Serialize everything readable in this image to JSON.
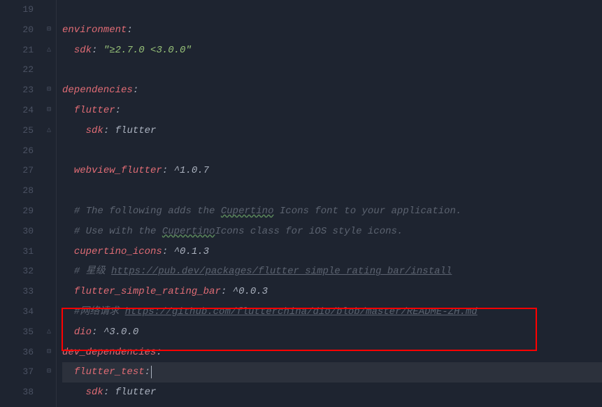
{
  "lines": [
    {
      "num": "19",
      "fold": "",
      "segments": []
    },
    {
      "num": "20",
      "fold": "⊟",
      "segments": [
        {
          "cls": "key",
          "t": "environment"
        },
        {
          "cls": "colon",
          "t": ":"
        }
      ]
    },
    {
      "num": "21",
      "fold": "△",
      "indent": 1,
      "segments": [
        {
          "cls": "key",
          "t": "sdk"
        },
        {
          "cls": "colon",
          "t": ": "
        },
        {
          "cls": "string",
          "t": "\"≥2.7.0 <3.0.0\""
        }
      ]
    },
    {
      "num": "22",
      "fold": "",
      "segments": []
    },
    {
      "num": "23",
      "fold": "⊟",
      "segments": [
        {
          "cls": "key",
          "t": "dependencies"
        },
        {
          "cls": "colon",
          "t": ":"
        }
      ]
    },
    {
      "num": "24",
      "fold": "⊟",
      "indent": 1,
      "segments": [
        {
          "cls": "key",
          "t": "flutter"
        },
        {
          "cls": "colon",
          "t": ":"
        }
      ]
    },
    {
      "num": "25",
      "fold": "△",
      "indent": 2,
      "segments": [
        {
          "cls": "key",
          "t": "sdk"
        },
        {
          "cls": "colon",
          "t": ": "
        },
        {
          "cls": "plain",
          "t": "flutter"
        }
      ]
    },
    {
      "num": "26",
      "fold": "",
      "segments": []
    },
    {
      "num": "27",
      "fold": "",
      "indent": 1,
      "segments": [
        {
          "cls": "key",
          "t": "webview_flutter"
        },
        {
          "cls": "colon",
          "t": ": "
        },
        {
          "cls": "plain",
          "t": "^1.0.7"
        }
      ]
    },
    {
      "num": "28",
      "fold": "",
      "segments": []
    },
    {
      "num": "29",
      "fold": "",
      "indent": 1,
      "segments": [
        {
          "cls": "comment",
          "t": "# The following adds the "
        },
        {
          "cls": "comment wavy",
          "t": "Cupertino"
        },
        {
          "cls": "comment",
          "t": " Icons font to your application."
        }
      ]
    },
    {
      "num": "30",
      "fold": "",
      "indent": 1,
      "segments": [
        {
          "cls": "comment",
          "t": "# Use with the "
        },
        {
          "cls": "comment wavy",
          "t": "Cupertino"
        },
        {
          "cls": "comment",
          "t": "Icons class for iOS style icons."
        }
      ]
    },
    {
      "num": "31",
      "fold": "",
      "indent": 1,
      "segments": [
        {
          "cls": "key",
          "t": "cupertino_icons"
        },
        {
          "cls": "colon",
          "t": ": "
        },
        {
          "cls": "plain",
          "t": "^0.1.3"
        }
      ]
    },
    {
      "num": "32",
      "fold": "",
      "indent": 1,
      "segments": [
        {
          "cls": "comment",
          "t": "# 星级 "
        },
        {
          "cls": "link",
          "t": "https://pub.dev/packages/flutter_simple_rating_bar/install"
        }
      ]
    },
    {
      "num": "33",
      "fold": "",
      "indent": 1,
      "segments": [
        {
          "cls": "key",
          "t": "flutter_simple_rating_bar"
        },
        {
          "cls": "colon",
          "t": ": "
        },
        {
          "cls": "plain",
          "t": "^0.0.3"
        }
      ]
    },
    {
      "num": "34",
      "fold": "",
      "indent": 1,
      "segments": [
        {
          "cls": "comment",
          "t": "#网络请求 "
        },
        {
          "cls": "link",
          "t": "https://github.com/flutterchina/dio/blob/master/README-ZH.md"
        }
      ]
    },
    {
      "num": "35",
      "fold": "△",
      "indent": 1,
      "segments": [
        {
          "cls": "key",
          "t": "dio"
        },
        {
          "cls": "colon",
          "t": ": "
        },
        {
          "cls": "plain",
          "t": "^3.0.0"
        }
      ]
    },
    {
      "num": "36",
      "fold": "⊟",
      "segments": [
        {
          "cls": "key",
          "t": "dev_dependencies"
        },
        {
          "cls": "colon",
          "t": ":"
        }
      ]
    },
    {
      "num": "37",
      "fold": "⊟",
      "indent": 1,
      "current": true,
      "cursor": true,
      "segments": [
        {
          "cls": "key",
          "t": "flutter_test"
        },
        {
          "cls": "colon",
          "t": ":"
        }
      ]
    },
    {
      "num": "38",
      "fold": "",
      "indent": 2,
      "segments": [
        {
          "cls": "key",
          "t": "sdk"
        },
        {
          "cls": "colon",
          "t": ": "
        },
        {
          "cls": "plain",
          "t": "flutter"
        }
      ]
    }
  ]
}
